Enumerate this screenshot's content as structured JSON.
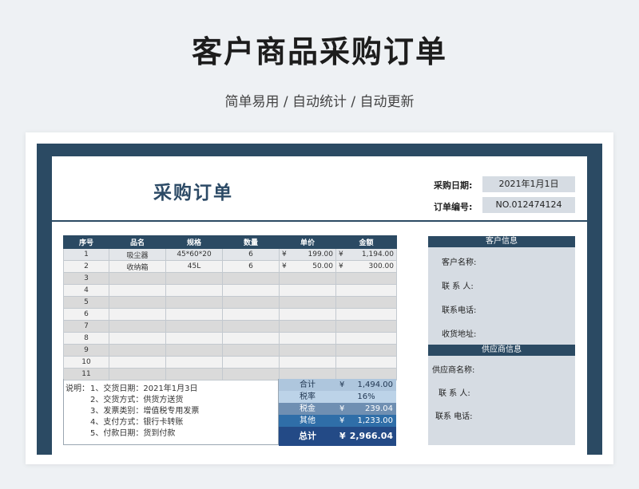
{
  "header": {
    "title": "客户商品采购订单",
    "subtitle": "简单易用 / 自动统计 / 自动更新"
  },
  "doc": {
    "title": "采购订单"
  },
  "meta": {
    "date_label": "采购日期:",
    "date_value": "2021年1月1日",
    "order_no_label": "订单编号:",
    "order_no_value": "NO.012474124"
  },
  "table": {
    "headers": [
      "序号",
      "品名",
      "规格",
      "数量",
      "单价",
      "金额"
    ],
    "currency": "¥",
    "rows": [
      {
        "no": "1",
        "name": "吸尘器",
        "spec": "45*60*20",
        "qty": "6",
        "price": "199.00",
        "amount": "1,194.00"
      },
      {
        "no": "2",
        "name": "收纳箱",
        "spec": "45L",
        "qty": "6",
        "price": "50.00",
        "amount": "300.00"
      },
      {
        "no": "3"
      },
      {
        "no": "4"
      },
      {
        "no": "5"
      },
      {
        "no": "6"
      },
      {
        "no": "7"
      },
      {
        "no": "8"
      },
      {
        "no": "9"
      },
      {
        "no": "10"
      },
      {
        "no": "11"
      }
    ]
  },
  "notes": {
    "prefix": "说明：",
    "lines": [
      "1、交货日期：2021年1月3日",
      "2、交货方式：供货方送货",
      "3、发票类别：增值税专用发票",
      "4、支付方式：银行卡转账",
      "5、付款日期：货到付款"
    ]
  },
  "summary": {
    "subtotal_label": "合计",
    "subtotal_value": "1,494.00",
    "tax_rate_label": "税率",
    "tax_rate_value": "16%",
    "tax_label": "税金",
    "tax_value": "239.04",
    "other_label": "其他",
    "other_value": "1,233.00",
    "total_label": "总计",
    "total_value": "2,966.04",
    "currency": "¥"
  },
  "customer": {
    "title": "客户信息",
    "name_label": "客户名称:",
    "contact_label": "联 系 人:",
    "phone_label": "联系电话:",
    "address_label": "收货地址:"
  },
  "supplier": {
    "title": "供应商信息",
    "name_label": "供应商名称:",
    "contact_label": "联 系 人:",
    "phone_label": "联系 电话:"
  },
  "colors": {
    "navy": "#2b4a63",
    "panel": "#d6dce3",
    "subtotal_bg": "#aec6dd",
    "tax_rate_bg": "#bcd3e8",
    "tax_bg": "#6f8fb2",
    "other_bg": "#2f6ea8",
    "total_bg": "#234a86"
  }
}
